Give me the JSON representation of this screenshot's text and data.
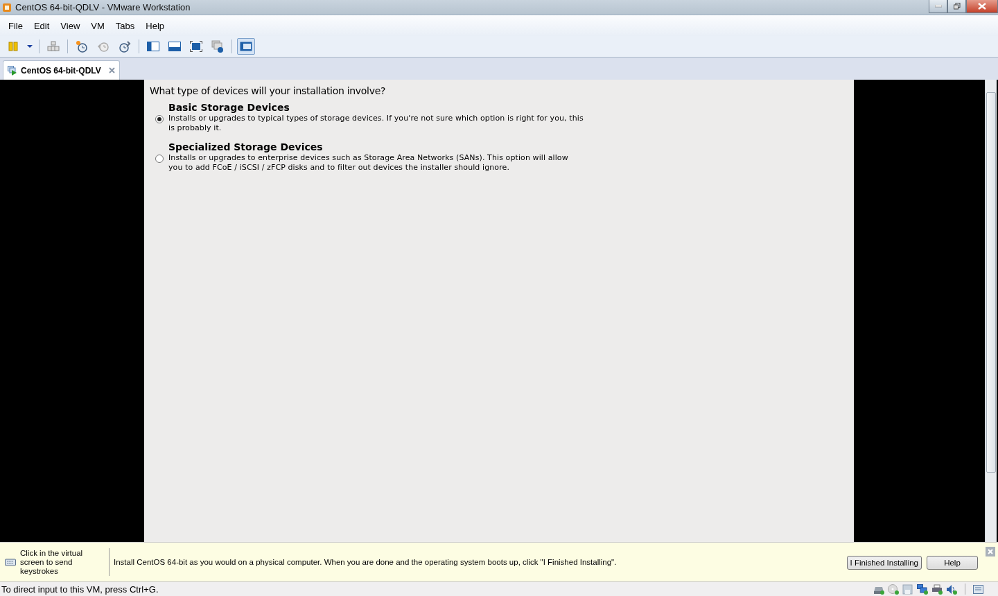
{
  "window": {
    "title": "CentOS 64-bit-QDLV - VMware Workstation"
  },
  "menus": [
    "File",
    "Edit",
    "View",
    "VM",
    "Tabs",
    "Help"
  ],
  "tabs": [
    {
      "label": "CentOS 64-bit-QDLV",
      "selected": true
    }
  ],
  "installer": {
    "question": "What type of devices will your installation involve?",
    "options": [
      {
        "title": "Basic Storage Devices",
        "description": "Installs or upgrades to typical types of storage devices.  If you're not sure which option is right for you, this is probably it.",
        "selected": true
      },
      {
        "title": "Specialized Storage Devices",
        "description": "Installs or upgrades to enterprise devices such as Storage Area Networks (SANs). This option will allow you to add FCoE / iSCSI / zFCP disks and to filter out devices the installer should ignore.",
        "selected": false
      }
    ]
  },
  "hint_bar": {
    "keystroke_hint": "Click in the virtual screen to send keystrokes",
    "message": "Install CentOS 64-bit as you would on a physical computer. When you are done and the operating system boots up, click \"I Finished Installing\".",
    "buttons": [
      "I Finished Installing",
      "Help"
    ]
  },
  "status_bar": {
    "text": "To direct input to this VM, press Ctrl+G."
  }
}
